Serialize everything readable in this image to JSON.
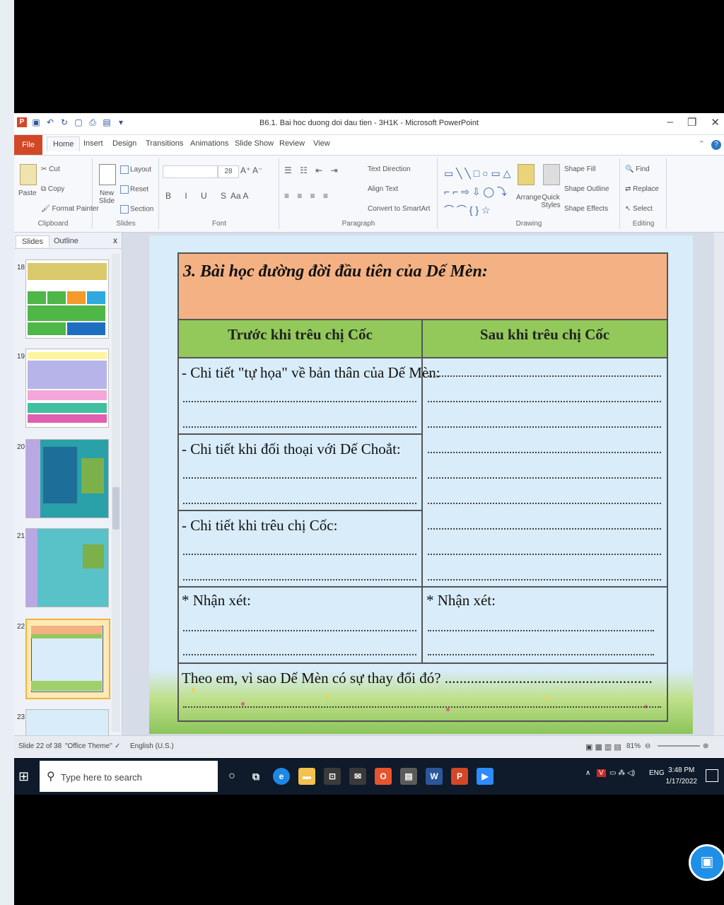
{
  "window": {
    "title": "B6.1. Bai hoc duong doi dau tien - 3H1K - Microsoft PowerPoint",
    "minimize": "–",
    "restore": "❐",
    "close": "✕"
  },
  "ribbon_tabs": [
    "File",
    "Home",
    "Insert",
    "Design",
    "Transitions",
    "Animations",
    "Slide Show",
    "Review",
    "View"
  ],
  "ribbon": {
    "clipboard": {
      "paste": "Paste",
      "cut": "Cut",
      "copy": "Copy",
      "format_painter": "Format Painter",
      "label": "Clipboard"
    },
    "slides": {
      "new_slide": "New Slide",
      "layout": "Layout",
      "reset": "Reset",
      "section": "Section",
      "label": "Slides"
    },
    "font": {
      "size": "28",
      "label": "Font"
    },
    "paragraph": {
      "text_direction": "Text Direction",
      "align_text": "Align Text",
      "convert": "Convert to SmartArt",
      "label": "Paragraph"
    },
    "drawing": {
      "arrange": "Arrange",
      "quick_styles": "Quick Styles",
      "shape_fill": "Shape Fill",
      "shape_outline": "Shape Outline",
      "shape_effects": "Shape Effects",
      "label": "Drawing"
    },
    "editing": {
      "find": "Find",
      "replace": "Replace",
      "select": "Select",
      "label": "Editing"
    }
  },
  "pane": {
    "tab_slides": "Slides",
    "tab_outline": "Outline",
    "close": "x",
    "thumbs": [
      "18",
      "19",
      "20",
      "21",
      "22",
      "23"
    ]
  },
  "slide": {
    "title": "3. Bài học đường đời đầu tiên của Dế Mèn:",
    "col_before": "Trước khi trêu chị Cốc",
    "col_after": "Sau khi trêu chị Cốc",
    "row1": "- Chi tiết \"tự họa\" về bản thân của Dế Mèn:",
    "row2": "- Chi tiết khi đối thoại với Dế Choắt:",
    "row3": "- Chi tiết khi trêu chị Cốc:",
    "comment_left": "* Nhận xét:",
    "comment_right": "* Nhận xét:",
    "question": "Theo em, vì sao Dế Mèn có sự thay đổi đó? ........................................................"
  },
  "status": {
    "slide_info": "Slide 22 of 38",
    "theme": "\"Office Theme\"",
    "language": "English (U.S.)",
    "zoom": "81%"
  },
  "taskbar": {
    "search_placeholder": "Type here to search",
    "lang": "ENG",
    "time": "3:48 PM",
    "date": "1/17/2022"
  },
  "colors": {
    "title_band": "#f4b183",
    "header_band": "#92c95a",
    "slide_bg": "#d8ecf9",
    "file_tab": "#d24726"
  }
}
